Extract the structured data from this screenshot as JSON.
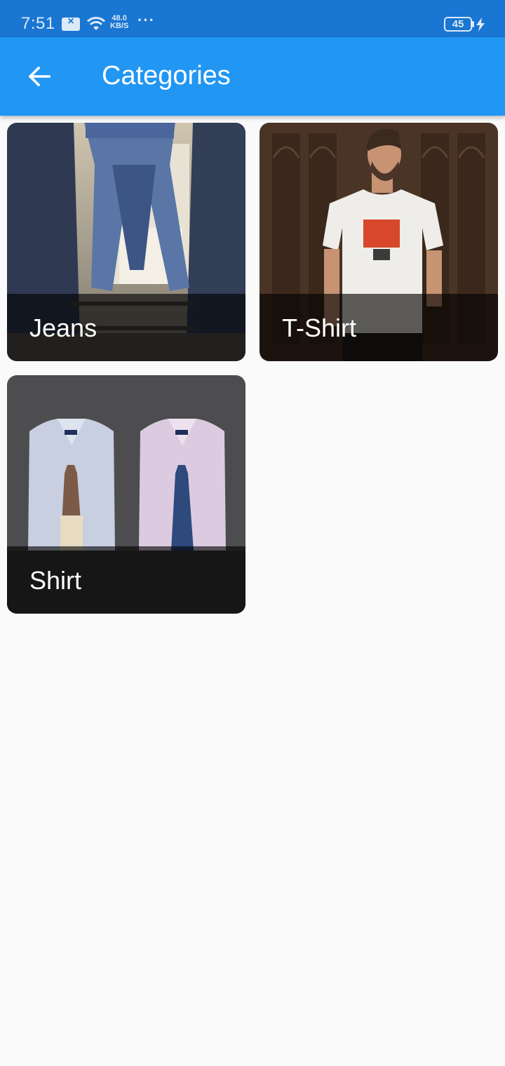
{
  "status_bar": {
    "time": "7:51",
    "speed_value": "48.0",
    "speed_unit": "KB/S",
    "more": "···",
    "battery_level": "45",
    "icons": [
      "notification-x-icon",
      "wifi-icon",
      "battery-icon",
      "charging-bolt-icon"
    ]
  },
  "app_bar": {
    "back_icon": "arrow-back-icon",
    "title": "Categories"
  },
  "categories": [
    {
      "label": "Jeans",
      "image": "jeans-photo"
    },
    {
      "label": "T-Shirt",
      "image": "tshirt-photo"
    },
    {
      "label": "Shirt",
      "image": "shirt-photo"
    }
  ],
  "colors": {
    "status_bar": "#1976d2",
    "app_bar": "#2196f3",
    "background": "#fafafa",
    "caption_overlay": "#000000"
  }
}
